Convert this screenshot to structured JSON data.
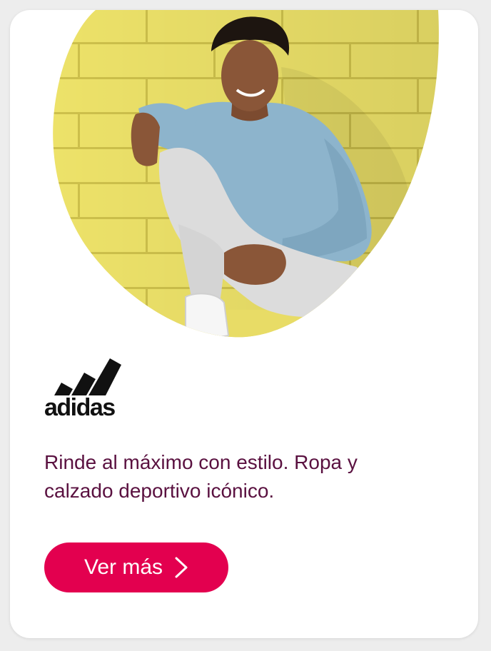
{
  "card": {
    "hero_image": "person-sitting-yellow-brick-wall",
    "brand": {
      "name": "adidas",
      "icon": "adidas-three-stripes-logo"
    },
    "description": "Rinde al máximo con estilo. Ropa y calzado deportivo icónico.",
    "cta": {
      "label": "Ver más",
      "icon": "chevron-right-icon"
    }
  },
  "colors": {
    "page_background": "#ededed",
    "card_background": "#ffffff",
    "text": "#5a1140",
    "button": "#e3004f",
    "button_text": "#ffffff",
    "wall_yellow": "#efe46a"
  }
}
